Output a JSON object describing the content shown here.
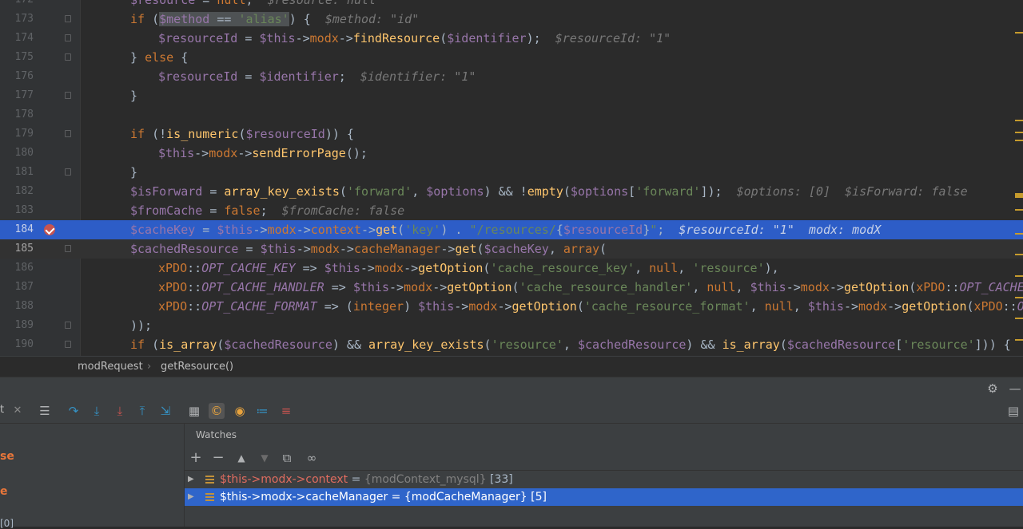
{
  "editor": {
    "lines": [
      {
        "n": "172",
        "segments": [
          [
            "var",
            "$resource"
          ],
          [
            "op",
            " = "
          ],
          [
            "kw",
            "null"
          ],
          [
            "op",
            ";  "
          ],
          [
            "hint",
            "$resource: null"
          ]
        ]
      },
      {
        "n": "173",
        "segments": [
          [
            "kw",
            "if "
          ],
          [
            "op",
            "("
          ],
          [
            "var sel",
            "$method"
          ],
          [
            "op sel",
            " == "
          ],
          [
            "str sel",
            "'alias'"
          ],
          [
            "op",
            ") {  "
          ],
          [
            "hint",
            "$method: \"id\""
          ]
        ]
      },
      {
        "n": "174",
        "indent": 1,
        "segments": [
          [
            "var",
            "$resourceId"
          ],
          [
            "op",
            " = "
          ],
          [
            "var",
            "$this"
          ],
          [
            "op",
            "->"
          ],
          [
            "cls",
            "modx"
          ],
          [
            "op",
            "->"
          ],
          [
            "fn",
            "findResource"
          ],
          [
            "op",
            "("
          ],
          [
            "var",
            "$identifier"
          ],
          [
            "op",
            ");  "
          ],
          [
            "hint",
            "$resourceId: \"1\""
          ]
        ]
      },
      {
        "n": "175",
        "segments": [
          [
            "op",
            "} "
          ],
          [
            "kw",
            "else "
          ],
          [
            "op",
            "{"
          ]
        ]
      },
      {
        "n": "176",
        "indent": 1,
        "segments": [
          [
            "var",
            "$resourceId"
          ],
          [
            "op",
            " = "
          ],
          [
            "var",
            "$identifier"
          ],
          [
            "op",
            ";  "
          ],
          [
            "hint",
            "$identifier: \"1\""
          ]
        ]
      },
      {
        "n": "177",
        "segments": [
          [
            "op",
            "}"
          ]
        ]
      },
      {
        "n": "178",
        "segments": []
      },
      {
        "n": "179",
        "segments": [
          [
            "kw",
            "if "
          ],
          [
            "op",
            "(!"
          ],
          [
            "fn",
            "is_numeric"
          ],
          [
            "op",
            "("
          ],
          [
            "var",
            "$resourceId"
          ],
          [
            "op",
            ")) {"
          ]
        ]
      },
      {
        "n": "180",
        "indent": 1,
        "segments": [
          [
            "var",
            "$this"
          ],
          [
            "op",
            "->"
          ],
          [
            "cls",
            "modx"
          ],
          [
            "op",
            "->"
          ],
          [
            "fn",
            "sendErrorPage"
          ],
          [
            "op",
            "();"
          ]
        ]
      },
      {
        "n": "181",
        "segments": [
          [
            "op",
            "}"
          ]
        ]
      },
      {
        "n": "182",
        "segments": [
          [
            "var",
            "$isForward"
          ],
          [
            "op",
            " = "
          ],
          [
            "fn",
            "array_key_exists"
          ],
          [
            "op",
            "("
          ],
          [
            "str",
            "'forward'"
          ],
          [
            "op",
            ", "
          ],
          [
            "var",
            "$options"
          ],
          [
            "op",
            ") && !"
          ],
          [
            "fn",
            "empty"
          ],
          [
            "op",
            "("
          ],
          [
            "var",
            "$options"
          ],
          [
            "op",
            "["
          ],
          [
            "str",
            "'forward'"
          ],
          [
            "op",
            "]);  "
          ],
          [
            "hint",
            "$options: [0]  $isForward: false"
          ]
        ]
      },
      {
        "n": "183",
        "segments": [
          [
            "var",
            "$fromCache"
          ],
          [
            "op",
            " = "
          ],
          [
            "kw",
            "false"
          ],
          [
            "op",
            ";  "
          ],
          [
            "hint",
            "$fromCache: false"
          ]
        ]
      },
      {
        "n": "184",
        "segments": [
          [
            "var",
            "$cacheKey"
          ],
          [
            "op",
            " = "
          ],
          [
            "var",
            "$this"
          ],
          [
            "op",
            "->"
          ],
          [
            "cls",
            "modx"
          ],
          [
            "op",
            "->"
          ],
          [
            "cls",
            "context"
          ],
          [
            "op",
            "->"
          ],
          [
            "fn",
            "get"
          ],
          [
            "op",
            "("
          ],
          [
            "str",
            "'key'"
          ],
          [
            "op",
            ") . "
          ],
          [
            "str",
            "\"/resources/"
          ],
          [
            "op",
            "{"
          ],
          [
            "var",
            "$resourceId"
          ],
          [
            "op",
            "}"
          ],
          [
            "str",
            "\""
          ],
          [
            "op",
            ";  "
          ],
          [
            "hint",
            "$resourceId: \"1\"  modx: modX"
          ]
        ]
      },
      {
        "n": "185",
        "segments": [
          [
            "var",
            "$cachedResource"
          ],
          [
            "op",
            " = "
          ],
          [
            "var",
            "$this"
          ],
          [
            "op",
            "->"
          ],
          [
            "cls",
            "modx"
          ],
          [
            "op",
            "->"
          ],
          [
            "cls",
            "cacheManager"
          ],
          [
            "op",
            "->"
          ],
          [
            "fn",
            "get"
          ],
          [
            "op",
            "("
          ],
          [
            "var",
            "$cacheKey"
          ],
          [
            "op",
            ", "
          ],
          [
            "kw",
            "array"
          ],
          [
            "op",
            "("
          ]
        ]
      },
      {
        "n": "186",
        "indent": 1,
        "segments": [
          [
            "cls",
            "xPDO"
          ],
          [
            "op",
            "::"
          ],
          [
            "const",
            "OPT_CACHE_KEY"
          ],
          [
            "op",
            " => "
          ],
          [
            "var",
            "$this"
          ],
          [
            "op",
            "->"
          ],
          [
            "cls",
            "modx"
          ],
          [
            "op",
            "->"
          ],
          [
            "fn",
            "getOption"
          ],
          [
            "op",
            "("
          ],
          [
            "str",
            "'cache_resource_key'"
          ],
          [
            "op",
            ", "
          ],
          [
            "kw",
            "null"
          ],
          [
            "op",
            ", "
          ],
          [
            "str",
            "'resource'"
          ],
          [
            "op",
            "),"
          ]
        ]
      },
      {
        "n": "187",
        "indent": 1,
        "segments": [
          [
            "cls",
            "xPDO"
          ],
          [
            "op",
            "::"
          ],
          [
            "const",
            "OPT_CACHE_HANDLER"
          ],
          [
            "op",
            " => "
          ],
          [
            "var",
            "$this"
          ],
          [
            "op",
            "->"
          ],
          [
            "cls",
            "modx"
          ],
          [
            "op",
            "->"
          ],
          [
            "fn",
            "getOption"
          ],
          [
            "op",
            "("
          ],
          [
            "str",
            "'cache_resource_handler'"
          ],
          [
            "op",
            ", "
          ],
          [
            "kw",
            "null"
          ],
          [
            "op",
            ", "
          ],
          [
            "var",
            "$this"
          ],
          [
            "op",
            "->"
          ],
          [
            "cls",
            "modx"
          ],
          [
            "op",
            "->"
          ],
          [
            "fn",
            "getOption"
          ],
          [
            "op",
            "("
          ],
          [
            "cls",
            "xPDO"
          ],
          [
            "op",
            "::"
          ],
          [
            "const",
            "OPT_CACHE_HA"
          ]
        ]
      },
      {
        "n": "188",
        "indent": 1,
        "segments": [
          [
            "cls",
            "xPDO"
          ],
          [
            "op",
            "::"
          ],
          [
            "const",
            "OPT_CACHE_FORMAT"
          ],
          [
            "op",
            " => ("
          ],
          [
            "kw",
            "integer"
          ],
          [
            "op",
            ") "
          ],
          [
            "var",
            "$this"
          ],
          [
            "op",
            "->"
          ],
          [
            "cls",
            "modx"
          ],
          [
            "op",
            "->"
          ],
          [
            "fn",
            "getOption"
          ],
          [
            "op",
            "("
          ],
          [
            "str",
            "'cache_resource_format'"
          ],
          [
            "op",
            ", "
          ],
          [
            "kw",
            "null"
          ],
          [
            "op",
            ", "
          ],
          [
            "var",
            "$this"
          ],
          [
            "op",
            "->"
          ],
          [
            "cls",
            "modx"
          ],
          [
            "op",
            "->"
          ],
          [
            "fn",
            "getOption"
          ],
          [
            "op",
            "("
          ],
          [
            "cls",
            "xPDO"
          ],
          [
            "op",
            "::"
          ],
          [
            "const",
            "OPT"
          ]
        ]
      },
      {
        "n": "189",
        "segments": [
          [
            "op",
            "));"
          ]
        ]
      },
      {
        "n": "190",
        "segments": [
          [
            "kw",
            "if "
          ],
          [
            "op",
            "("
          ],
          [
            "fn",
            "is_array"
          ],
          [
            "op",
            "("
          ],
          [
            "var",
            "$cachedResource"
          ],
          [
            "op",
            ") && "
          ],
          [
            "fn",
            "array_key_exists"
          ],
          [
            "op",
            "("
          ],
          [
            "str",
            "'resource'"
          ],
          [
            "op",
            ", "
          ],
          [
            "var",
            "$cachedResource"
          ],
          [
            "op",
            ") && "
          ],
          [
            "fn",
            "is_array"
          ],
          [
            "op",
            "("
          ],
          [
            "var",
            "$cachedResource"
          ],
          [
            "op",
            "["
          ],
          [
            "str",
            "'resource'"
          ],
          [
            "op",
            "])) {"
          ]
        ]
      }
    ]
  },
  "breadcrumb": {
    "class_name": "modRequest",
    "separator": "›",
    "method": "getResource()"
  },
  "left_pane": {
    "fragments": [
      "se",
      "e",
      "[0]"
    ]
  },
  "toolbar": {
    "tab_fragment": "t"
  },
  "watches": {
    "title": "Watches",
    "items": [
      {
        "name": "$this->modx->context",
        "eq": " = ",
        "type": "{modContext_mysql}",
        "count": " [33]"
      },
      {
        "name": "$this->modx->cacheManager",
        "eq": " = ",
        "type": "{modCacheManager}",
        "count": " [5]"
      }
    ]
  },
  "colors": {
    "accent": "#2d5dc7",
    "selection": "#2f65ca",
    "keyword": "#cc7832",
    "variable": "#9876aa",
    "function": "#ffc66d",
    "string": "#6a8759"
  }
}
